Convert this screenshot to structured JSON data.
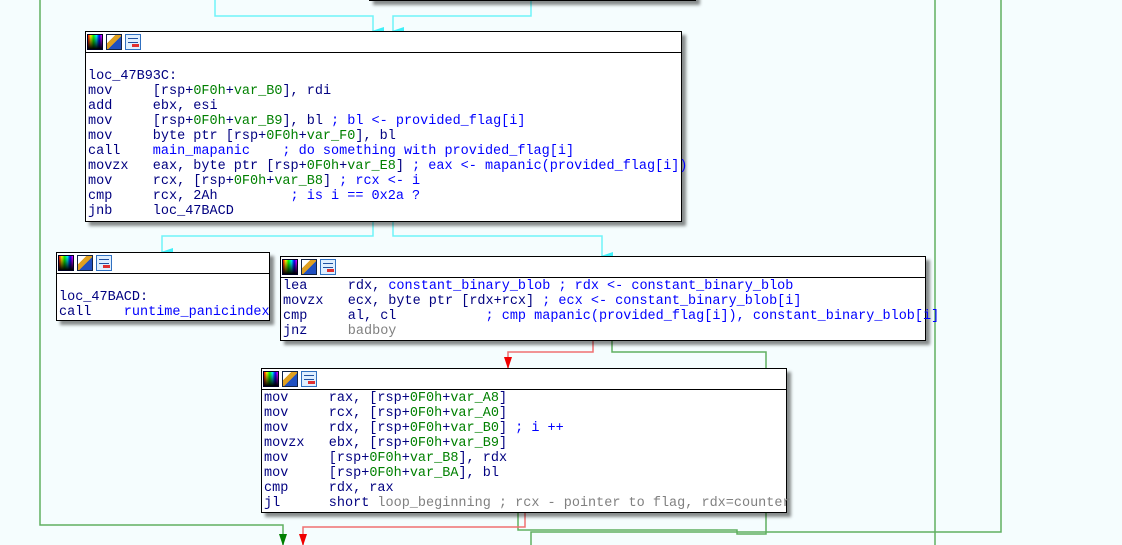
{
  "view": "IDA graph view",
  "colors": {
    "mnemonic": "#000080",
    "number": "#008000",
    "name": "#0000ff",
    "gray": "#808080",
    "edge_normal": "#40f0f8",
    "edge_true": "#50b050",
    "edge_false": "#f03030"
  },
  "header_icons": [
    "color-palette-icon",
    "edit-pencil-icon",
    "graph-icon"
  ],
  "blocks": [
    {
      "id": "loc_47B93C",
      "label": "loc_47B93C:",
      "blank_before": true,
      "lines": [
        {
          "mn": "mov",
          "ops": [
            {
              "t": "[rsp+",
              "c": "n"
            },
            {
              "t": "0F0h",
              "c": "g"
            },
            {
              "t": "+",
              "c": "n"
            },
            {
              "t": "var_B0",
              "c": "g"
            },
            {
              "t": "], rdi",
              "c": "n"
            }
          ]
        },
        {
          "mn": "add",
          "ops": [
            {
              "t": "ebx, esi",
              "c": "n"
            }
          ]
        },
        {
          "mn": "mov",
          "ops": [
            {
              "t": "[rsp+",
              "c": "n"
            },
            {
              "t": "0F0h",
              "c": "g"
            },
            {
              "t": "+",
              "c": "n"
            },
            {
              "t": "var_B9",
              "c": "g"
            },
            {
              "t": "], bl ",
              "c": "n"
            },
            {
              "t": "; bl <- provided_flag[i]",
              "c": "b"
            }
          ]
        },
        {
          "mn": "mov",
          "ops": [
            {
              "t": "byte ptr [rsp+",
              "c": "n"
            },
            {
              "t": "0F0h",
              "c": "g"
            },
            {
              "t": "+",
              "c": "n"
            },
            {
              "t": "var_F0",
              "c": "g"
            },
            {
              "t": "], bl",
              "c": "n"
            }
          ]
        },
        {
          "mn": "call",
          "ops": [
            {
              "t": "main_mapanic",
              "c": "b"
            },
            {
              "t": "    ; do something with provided_flag[i]",
              "c": "b"
            }
          ]
        },
        {
          "mn": "movzx",
          "ops": [
            {
              "t": "eax, byte ptr [rsp+",
              "c": "n"
            },
            {
              "t": "0F0h",
              "c": "g"
            },
            {
              "t": "+",
              "c": "n"
            },
            {
              "t": "var_E8",
              "c": "g"
            },
            {
              "t": "] ",
              "c": "n"
            },
            {
              "t": "; eax <- mapanic(provided_flag[i])",
              "c": "b"
            }
          ]
        },
        {
          "mn": "mov",
          "ops": [
            {
              "t": "rcx, [rsp+",
              "c": "n"
            },
            {
              "t": "0F0h",
              "c": "g"
            },
            {
              "t": "+",
              "c": "n"
            },
            {
              "t": "var_B8",
              "c": "g"
            },
            {
              "t": "] ",
              "c": "n"
            },
            {
              "t": "; rcx <- i",
              "c": "b"
            }
          ]
        },
        {
          "mn": "cmp",
          "ops": [
            {
              "t": "rcx, 2Ah",
              "c": "n"
            },
            {
              "t": "         ; is i == 0x2a ?",
              "c": "b"
            }
          ]
        },
        {
          "mn": "jnb",
          "ops": [
            {
              "t": "loc_47BACD",
              "c": "n"
            }
          ]
        }
      ]
    },
    {
      "id": "loc_47BACD",
      "label": "loc_47BACD:",
      "blank_before": true,
      "lines": [
        {
          "mn": "call",
          "ops": [
            {
              "t": "runtime_panicindex",
              "c": "b"
            }
          ]
        }
      ]
    },
    {
      "id": "compare",
      "label": "",
      "blank_before": false,
      "lines": [
        {
          "mn": "lea",
          "ops": [
            {
              "t": "rdx, ",
              "c": "n"
            },
            {
              "t": "constant_binary_blob",
              "c": "b"
            },
            {
              "t": " ; rdx <- constant_binary_blob",
              "c": "b"
            }
          ]
        },
        {
          "mn": "movzx",
          "ops": [
            {
              "t": "ecx, byte ptr [rdx+rcx] ",
              "c": "n"
            },
            {
              "t": "; ecx <- constant_binary_blob[i]",
              "c": "b"
            }
          ]
        },
        {
          "mn": "cmp",
          "ops": [
            {
              "t": "al, cl",
              "c": "n"
            },
            {
              "t": "           ; cmp mapanic(provided_flag[i]), constant_binary_blob[i]",
              "c": "b"
            }
          ]
        },
        {
          "mn": "jnz",
          "ops": [
            {
              "t": "badboy",
              "c": "x"
            }
          ]
        }
      ]
    },
    {
      "id": "increment",
      "label": "",
      "blank_before": false,
      "lines": [
        {
          "mn": "mov",
          "ops": [
            {
              "t": "rax, [rsp+",
              "c": "n"
            },
            {
              "t": "0F0h",
              "c": "g"
            },
            {
              "t": "+",
              "c": "n"
            },
            {
              "t": "var_A8",
              "c": "g"
            },
            {
              "t": "]",
              "c": "n"
            }
          ]
        },
        {
          "mn": "mov",
          "ops": [
            {
              "t": "rcx, [rsp+",
              "c": "n"
            },
            {
              "t": "0F0h",
              "c": "g"
            },
            {
              "t": "+",
              "c": "n"
            },
            {
              "t": "var_A0",
              "c": "g"
            },
            {
              "t": "]",
              "c": "n"
            }
          ]
        },
        {
          "mn": "mov",
          "ops": [
            {
              "t": "rdx, [rsp+",
              "c": "n"
            },
            {
              "t": "0F0h",
              "c": "g"
            },
            {
              "t": "+",
              "c": "n"
            },
            {
              "t": "var_B0",
              "c": "g"
            },
            {
              "t": "] ",
              "c": "n"
            },
            {
              "t": "; i ++",
              "c": "b"
            }
          ]
        },
        {
          "mn": "movzx",
          "ops": [
            {
              "t": "ebx, [rsp+",
              "c": "n"
            },
            {
              "t": "0F0h",
              "c": "g"
            },
            {
              "t": "+",
              "c": "n"
            },
            {
              "t": "var_B9",
              "c": "g"
            },
            {
              "t": "]",
              "c": "n"
            }
          ]
        },
        {
          "mn": "mov",
          "ops": [
            {
              "t": "[rsp+",
              "c": "n"
            },
            {
              "t": "0F0h",
              "c": "g"
            },
            {
              "t": "+",
              "c": "n"
            },
            {
              "t": "var_B8",
              "c": "g"
            },
            {
              "t": "], rdx",
              "c": "n"
            }
          ]
        },
        {
          "mn": "mov",
          "ops": [
            {
              "t": "[rsp+",
              "c": "n"
            },
            {
              "t": "0F0h",
              "c": "g"
            },
            {
              "t": "+",
              "c": "n"
            },
            {
              "t": "var_BA",
              "c": "g"
            },
            {
              "t": "], bl",
              "c": "n"
            }
          ]
        },
        {
          "mn": "cmp",
          "ops": [
            {
              "t": "rdx, rax",
              "c": "n"
            }
          ]
        },
        {
          "mn": "jl",
          "ops": [
            {
              "t": "short ",
              "c": "n"
            },
            {
              "t": "loop_beginning",
              "c": "x"
            },
            {
              "t": " ; rcx - pointer to flag, rdx=counter",
              "c": "x"
            }
          ]
        }
      ]
    }
  ]
}
